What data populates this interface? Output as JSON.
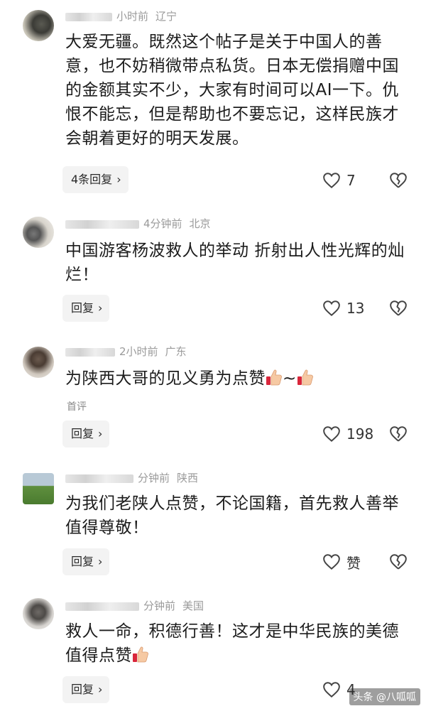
{
  "comments": [
    {
      "time": "小时前",
      "location": "辽宁",
      "text": "大爱无疆。既然这个帖子是关于中国人的善意，也不妨稍微带点私货。日本无偿捐赠中国的金额其实不少，大家有时间可以AI一下。仇恨不能忘，但是帮助也不要忘记，这样民族才会朝着更好的明天发展。",
      "reply_label": "4条回复",
      "likes": "7"
    },
    {
      "time": "4分钟前",
      "location": "北京",
      "text": "中国游客杨波救人的举动 折射出人性光辉的灿烂！",
      "reply_label": "回复",
      "likes": "13"
    },
    {
      "time": "2小时前",
      "location": "广东",
      "text": "为陕西大哥的见义勇为点赞",
      "text_suffix": "~",
      "tag": "首评",
      "reply_label": "回复",
      "likes": "198"
    },
    {
      "time": "分钟前",
      "location": "陕西",
      "text": "为我们老陕人点赞，不论国籍，首先救人善举值得尊敬！",
      "reply_label": "回复",
      "likes": "赞"
    },
    {
      "time": "分钟前",
      "location": "美国",
      "text": "救人一命，积德行善！这才是中华民族的美德值得点赞",
      "reply_label": "回复",
      "likes": "4"
    }
  ],
  "icons": {
    "reply_chevron": "chevron-right-icon",
    "like": "heart-outline-icon",
    "dislike": "broken-heart-icon",
    "thumb": "thumbs-up-emoji"
  },
  "watermark": "头条 @八呱呱"
}
